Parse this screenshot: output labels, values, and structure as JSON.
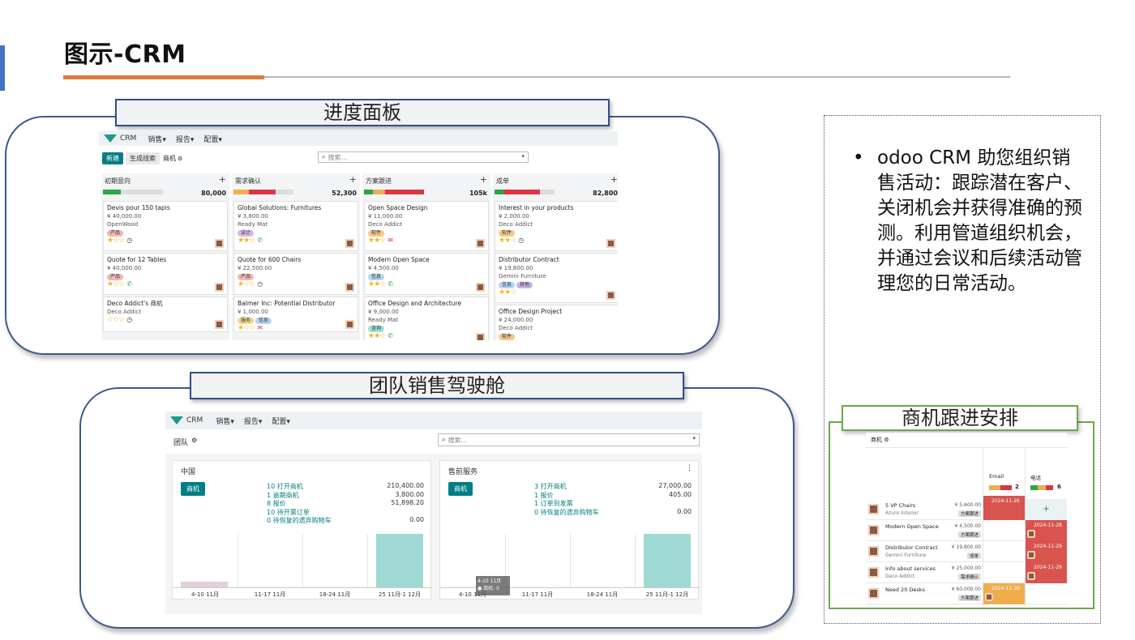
{
  "slide": {
    "title": "图示-CRM",
    "section1_title": "进度面板",
    "section2_title": "团队销售驾驶舱",
    "section3_title": "商机跟进安排",
    "bullet": "odoo CRM 助您组织销售活动：跟踪潜在客户、关闭机会并获得准确的预测。利用管道组织机会，并通过会议和后续活动管理您的日常活动。"
  },
  "kanban": {
    "app_name": "CRM",
    "menu": [
      "销售▾",
      "报告▾",
      "配置▾"
    ],
    "btn_new": "新建",
    "btn_generate": "生成线索",
    "breadcrumb": "商机",
    "search_placeholder": "搜索...",
    "columns": [
      {
        "name": "初期意向",
        "amount": "80,000",
        "bar": [
          [
            "#28a745",
            0.3
          ],
          [
            "#ddd",
            0.7
          ]
        ],
        "cards": [
          {
            "name": "Devis pour 150 tapis",
            "amount": "¥ 40,000.00",
            "company": "OpenWood",
            "tags": [
              [
                "产品",
                "#f4b6b6"
              ]
            ],
            "stars": "★☆☆",
            "act": "clock"
          },
          {
            "name": "Quote for 12 Tables",
            "amount": "¥ 40,000.00",
            "company": "",
            "tags": [
              [
                "产品",
                "#f4b6b6"
              ]
            ],
            "stars": "★☆☆",
            "act": "phone"
          },
          {
            "name": "Deco Addict's 商机",
            "amount": "",
            "company": "Deco Addict",
            "tags": [],
            "stars": "☆☆☆",
            "act": "clock"
          }
        ]
      },
      {
        "name": "需求确认",
        "amount": "52,300",
        "bar": [
          [
            "#f0ad4e",
            0.25
          ],
          [
            "#dc3545",
            0.45
          ],
          [
            "#ddd",
            0.3
          ]
        ],
        "cards": [
          {
            "name": "Global Solutions: Furnitures",
            "amount": "¥ 3,800.00",
            "company": "Ready Mat",
            "tags": [
              [
                "设计",
                "#d8b6e8"
              ]
            ],
            "stars": "★★☆",
            "act": "phone"
          },
          {
            "name": "Quote for 600 Chairs",
            "amount": "¥ 22,500.00",
            "company": "",
            "tags": [
              [
                "产品",
                "#f4b6b6"
              ]
            ],
            "stars": "★☆☆",
            "act": "clock"
          },
          {
            "name": "Balmer Inc: Potential Distributor",
            "amount": "¥ 1,000.00",
            "company": "",
            "tags": [
              [
                "服务",
                "#f6d58a"
              ],
              [
                "信息",
                "#b8d4f4"
              ]
            ],
            "stars": "★☆☆",
            "act": "mail"
          }
        ]
      },
      {
        "name": "方案跟进",
        "amount": "105k",
        "bar": [
          [
            "#28a745",
            0.15
          ],
          [
            "#f0ad4e",
            0.2
          ],
          [
            "#dc3545",
            0.65
          ]
        ],
        "cards": [
          {
            "name": "Open Space Design",
            "amount": "¥ 11,000.00",
            "company": "Deco Addict",
            "tags": [
              [
                "软件",
                "#f6c98a"
              ]
            ],
            "stars": "★★☆",
            "act": "mail"
          },
          {
            "name": "Modern Open Space",
            "amount": "¥ 4,500.00",
            "company": "",
            "tags": [
              [
                "信息",
                "#b8d4f4"
              ]
            ],
            "stars": "★★☆",
            "act": "phone"
          },
          {
            "name": "Office Design and Architecture",
            "amount": "¥ 9,000.00",
            "company": "Ready Mat",
            "tags": [
              [
                "咨询",
                "#9fe0d8"
              ]
            ],
            "stars": "★★☆",
            "act": "phone"
          }
        ]
      },
      {
        "name": "成单",
        "amount": "82,800",
        "bar": [
          [
            "#28a745",
            0.15
          ],
          [
            "#dc3545",
            0.6
          ],
          [
            "#ddd",
            0.25
          ]
        ],
        "cards": [
          {
            "name": "Interest in your products",
            "amount": "¥ 2,000.00",
            "company": "Deco Addict",
            "tags": [
              [
                "软件",
                "#f6c98a"
              ]
            ],
            "stars": "★★☆",
            "act": "clock"
          },
          {
            "name": "Distributor Contract",
            "amount": "¥ 19,800.00",
            "company": "Gemini Furniture",
            "tags": [
              [
                "信息",
                "#b8d4f4"
              ],
              [
                "其他",
                "#c8b6e8"
              ]
            ],
            "stars": "★★☆",
            "act": ""
          },
          {
            "name": "Office Design Project",
            "amount": "¥ 24,000.00",
            "company": "Deco Addict",
            "tags": [
              [
                "软件",
                "#f6c98a"
              ]
            ],
            "stars": "",
            "act": ""
          }
        ]
      }
    ]
  },
  "dashboard": {
    "app_name": "CRM",
    "menu": [
      "销售▾",
      "报告▾",
      "配置▾"
    ],
    "breadcrumb": "团队",
    "search_placeholder": "搜索...",
    "teams": [
      {
        "name": "中国",
        "btn": "商机",
        "stats": [
          [
            "10 打开商机",
            "210,400.00"
          ],
          [
            "1 逾期商机",
            "3,800.00"
          ],
          [
            "8 报价",
            "51,898.20"
          ],
          [
            "10 待开票订单",
            ""
          ],
          [
            "0 待恢复的遗弃购物车",
            "0.00"
          ]
        ],
        "x_labels": [
          "4-10 11月",
          "11-17 11月",
          "18-24 11月",
          "25 11月-1 12月"
        ],
        "bars": [
          0.1,
          0,
          0,
          1.0
        ]
      },
      {
        "name": "售前服务",
        "btn": "商机",
        "stats": [
          [
            "3 打开商机",
            "27,000.00"
          ],
          [
            "1 报价",
            "405.00"
          ],
          [
            "1 订单到发票",
            ""
          ],
          [
            "0 待恢复的遗弃购物车",
            "0.00"
          ]
        ],
        "x_labels": [
          "4-10 11月",
          "11-17 11月",
          "18-24 11月",
          "25 11月-1 12月"
        ],
        "bars": [
          0,
          0,
          0,
          1.0
        ],
        "tooltip": [
          "4-10 11月",
          "● 商机: 0"
        ]
      }
    ]
  },
  "schedule": {
    "breadcrumb": "商机",
    "col_email": "Email",
    "col_phone": "电话",
    "email_count": "2",
    "phone_count": "6",
    "rows": [
      {
        "name": "5 VP Chairs",
        "company": "Azure Interior",
        "amount": "¥ 5,600.00",
        "stage": "方案跟进",
        "email": "2024-11-26",
        "phone": "+"
      },
      {
        "name": "Modern Open Space",
        "company": "",
        "amount": "¥ 4,500.00",
        "stage": "方案跟进",
        "email": "",
        "phone": "2024-11-28"
      },
      {
        "name": "Distributor Contract",
        "company": "Gemini Furniture",
        "amount": "¥ 19,800.00",
        "stage": "成单",
        "email": "",
        "phone": "2024-11-29"
      },
      {
        "name": "Info about services",
        "company": "Deco Addict",
        "amount": "¥ 25,000.00",
        "stage": "需求确认",
        "email": "",
        "phone": "2024-11-29"
      },
      {
        "name": "Need 20 Desks",
        "company": "",
        "amount": "¥ 60,000.00",
        "stage": "方案跟进",
        "email": "2024-11-30",
        "phone": ""
      }
    ]
  },
  "colors": {
    "accent": "#017e84",
    "orange": "#e07b39",
    "blue": "#4472c4",
    "overdue": "#d9534f",
    "today": "#f0ad4e"
  }
}
